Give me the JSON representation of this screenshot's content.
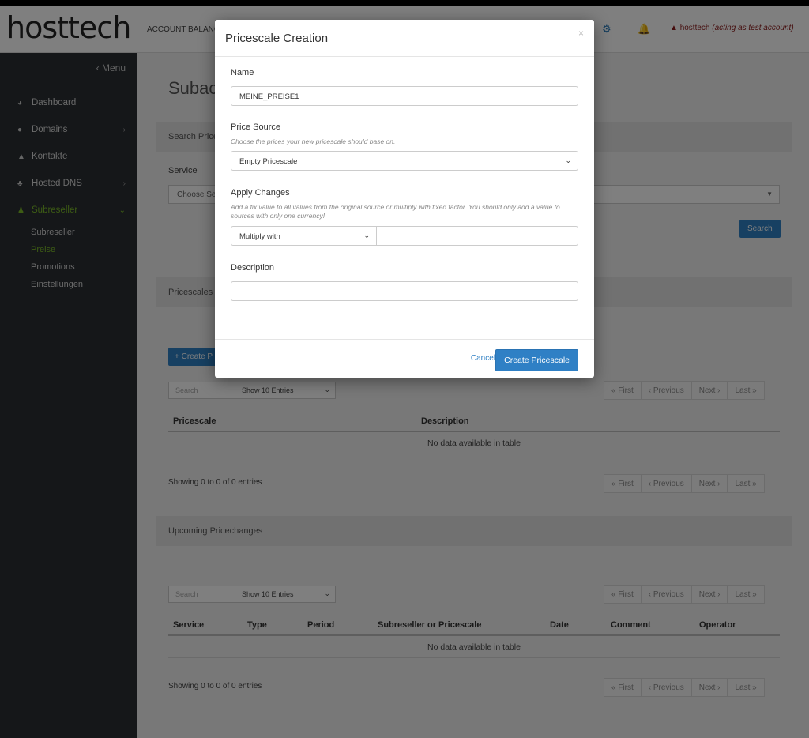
{
  "header": {
    "logo": "hosttech",
    "account_label": "ACCOUNT BALANCE",
    "user_name": "hosttech",
    "user_acting": "(acting as test.account)",
    "icons": [
      "cogs-icon",
      "bell-icon",
      "user-icon"
    ]
  },
  "sidebar": {
    "menu_toggle": "‹ Menu",
    "items": [
      {
        "label": "Dashboard",
        "icon": "dashboard-icon"
      },
      {
        "label": "Domains",
        "icon": "globe-icon"
      },
      {
        "label": "Kontakte",
        "icon": "user-icon"
      },
      {
        "label": "Hosted DNS",
        "icon": "sitemap-icon"
      },
      {
        "label": "Subreseller",
        "icon": "users-icon"
      }
    ],
    "subitems": [
      "Subreseller",
      "Preise",
      "Promotions",
      "Einstellungen"
    ]
  },
  "main": {
    "title": "Subac",
    "search_panel": "Search Price",
    "service_label": "Service",
    "service_placeholder": "Choose Ser",
    "search_button": "Search",
    "pricescales_panel": "Pricescales",
    "create_button": "+ Create P",
    "table1": {
      "search_placeholder": "Search",
      "entries": "Show 10 Entries",
      "columns": [
        "Pricescale",
        "Description"
      ],
      "empty": "No data available in table",
      "showing": "Showing 0 to 0 of 0 entries"
    },
    "upcoming_panel": "Upcoming Pricechanges",
    "table2": {
      "search_placeholder": "Search",
      "entries": "Show 10 Entries",
      "columns": [
        "Service",
        "Type",
        "Period",
        "Subreseller or Pricescale",
        "Date",
        "Comment",
        "Operator"
      ],
      "empty": "No data available in table",
      "showing": "Showing 0 to 0 of 0 entries"
    },
    "pager": [
      "« First",
      "‹ Previous",
      "Next ›",
      "Last »"
    ]
  },
  "modal": {
    "title": "Pricescale Creation",
    "close": "×",
    "name_label": "Name",
    "name_value": "MEINE_PREISE1",
    "source_label": "Price Source",
    "source_help": "Choose the prices your new pricescale should base on.",
    "source_value": "Empty Pricescale",
    "changes_label": "Apply Changes",
    "changes_help": "Add a fix value to all values from the original source or multiply with fixed factor. You should only add a value to sources with only one currency!",
    "changes_mode": "Multiply with",
    "changes_value": "",
    "description_label": "Description",
    "description_value": "",
    "cancel": "Cancel",
    "create": "Create Pricescale"
  },
  "colors": {
    "accent": "#2f80c5",
    "active_nav": "#7ab929",
    "sidebar": "#2a2f33"
  }
}
